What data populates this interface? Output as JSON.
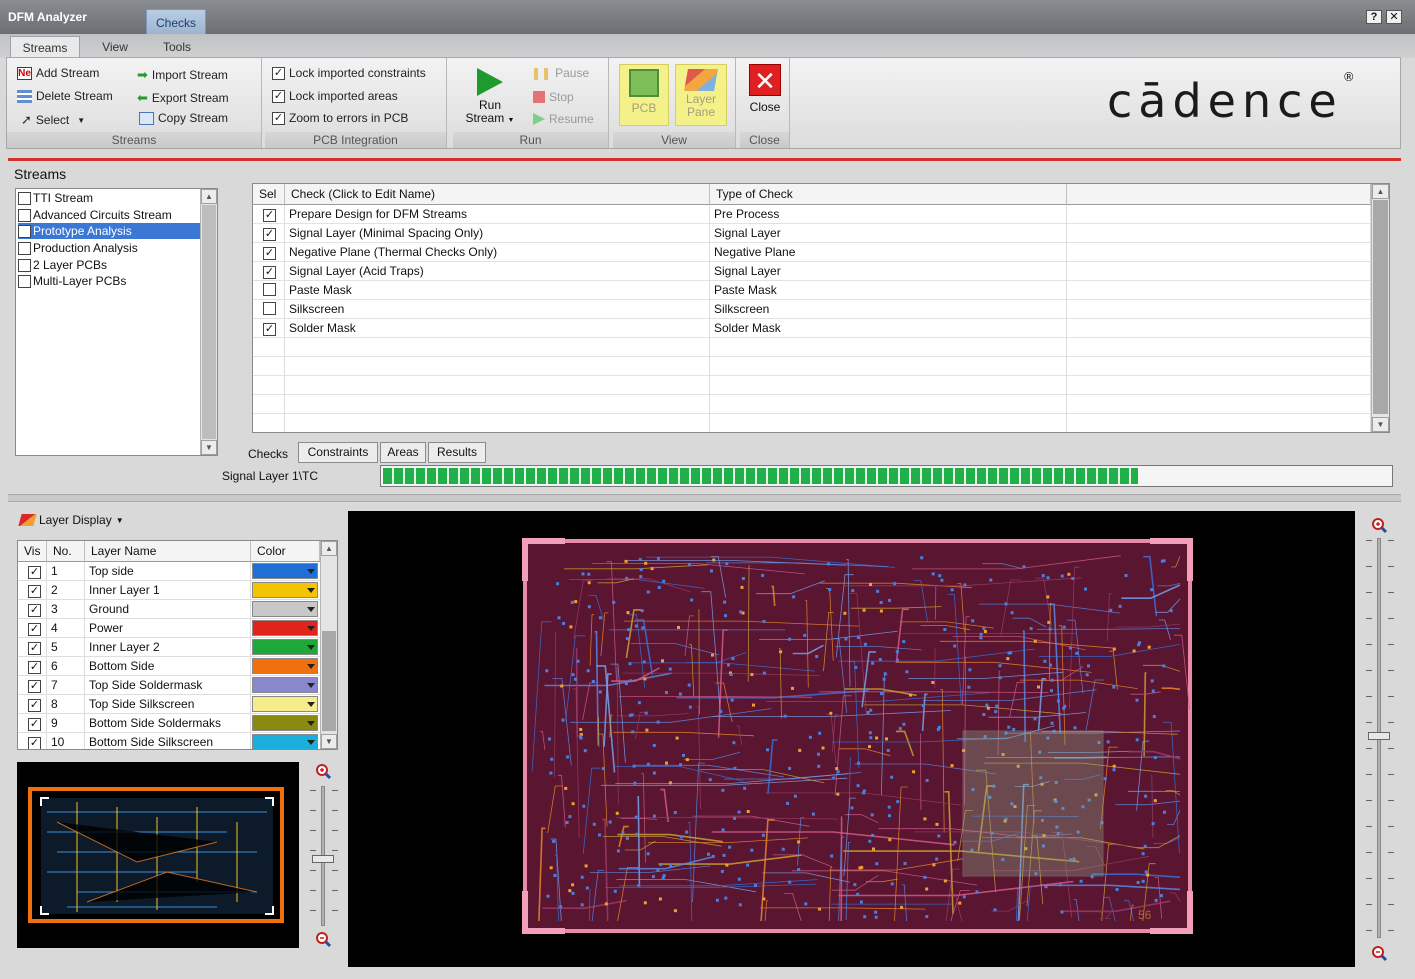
{
  "window": {
    "title": "DFM Analyzer",
    "context_tab": "Checks",
    "help_button": "?",
    "close_button": "✕"
  },
  "ribbon_tabs": [
    "Streams",
    "View",
    "Tools"
  ],
  "ribbon": {
    "streams_group": {
      "label": "Streams",
      "add_stream": "Add Stream",
      "delete_stream": "Delete Stream",
      "select": "Select",
      "import_stream": "Import Stream",
      "export_stream": "Export Stream",
      "copy_stream": "Copy Stream"
    },
    "pcb_integration_group": {
      "label": "PCB Integration",
      "lock_constraints": "Lock imported constraints",
      "lock_areas": "Lock imported areas",
      "zoom_errors": "Zoom to errors in PCB",
      "lock_constraints_checked": true,
      "lock_areas_checked": true,
      "zoom_errors_checked": true
    },
    "run_group": {
      "label": "Run",
      "run_stream_line1": "Run",
      "run_stream_line2": "Stream",
      "pause": "Pause",
      "stop": "Stop",
      "resume": "Resume"
    },
    "view_group": {
      "label": "View",
      "pcb": "PCB",
      "layer_pane_line1": "Layer",
      "layer_pane_line2": "Pane"
    },
    "close_group": {
      "label": "Close",
      "close": "Close"
    },
    "brand_logo": "cādence",
    "brand_registered": "®"
  },
  "streams_panel": {
    "title": "Streams",
    "items": [
      {
        "label": "TTI Stream",
        "checked": false,
        "selected": false
      },
      {
        "label": "Advanced Circuits Stream",
        "checked": false,
        "selected": false
      },
      {
        "label": "Prototype Analysis",
        "checked": true,
        "selected": true
      },
      {
        "label": "Production Analysis",
        "checked": false,
        "selected": false
      },
      {
        "label": "2 Layer PCBs",
        "checked": false,
        "selected": false
      },
      {
        "label": "Multi-Layer PCBs",
        "checked": false,
        "selected": false
      }
    ]
  },
  "checks_grid": {
    "columns": [
      "Sel",
      "Check (Click to Edit Name)",
      "Type of Check"
    ],
    "rows": [
      {
        "sel": true,
        "check": "Prepare Design for DFM Streams",
        "type": "Pre Process"
      },
      {
        "sel": true,
        "check": "Signal Layer (Minimal Spacing Only)",
        "type": "Signal Layer"
      },
      {
        "sel": true,
        "check": "Negative Plane (Thermal Checks Only)",
        "type": "Negative Plane"
      },
      {
        "sel": true,
        "check": "Signal Layer (Acid Traps)",
        "type": "Signal Layer"
      },
      {
        "sel": false,
        "check": "Paste Mask",
        "type": "Paste Mask"
      },
      {
        "sel": false,
        "check": "Silkscreen",
        "type": "Silkscreen"
      },
      {
        "sel": true,
        "check": "Solder Mask",
        "type": "Solder Mask"
      }
    ]
  },
  "bottom_tabs": [
    "Checks",
    "Constraints",
    "Areas",
    "Results"
  ],
  "status": {
    "progress_label": "Signal Layer 1\\TC",
    "progress_fraction": 0.75
  },
  "layer_display": {
    "title": "Layer Display",
    "columns": [
      "Vis",
      "No.",
      "Layer Name",
      "Color"
    ],
    "rows": [
      {
        "vis": true,
        "no": "1",
        "name": "Top side",
        "color": "#1f6fd6"
      },
      {
        "vis": true,
        "no": "2",
        "name": "Inner Layer 1",
        "color": "#f5c400"
      },
      {
        "vis": true,
        "no": "3",
        "name": "Ground",
        "color": "#c8c8c8"
      },
      {
        "vis": true,
        "no": "4",
        "name": "Power",
        "color": "#e2231a"
      },
      {
        "vis": true,
        "no": "5",
        "name": "Inner Layer 2",
        "color": "#1fa83a"
      },
      {
        "vis": true,
        "no": "6",
        "name": "Bottom Side",
        "color": "#f07010"
      },
      {
        "vis": true,
        "no": "7",
        "name": "Top Side Soldermask",
        "color": "#8a88cc"
      },
      {
        "vis": true,
        "no": "8",
        "name": "Top Side Silkscreen",
        "color": "#f7ec8a"
      },
      {
        "vis": true,
        "no": "9",
        "name": "Bottom Side Soldermaks",
        "color": "#8a8a10"
      },
      {
        "vis": true,
        "no": "10",
        "name": "Bottom Side Silkscreen",
        "color": "#1aaedc"
      }
    ]
  },
  "canvas": {
    "board_label_1": "12",
    "board_label_2": "56"
  },
  "colors": {
    "accent_red": "#d7322a",
    "progress_green": "#1fb04a",
    "selection_blue": "#3b78d6",
    "board_fill": "#5a1530",
    "board_outline": "#e88aa8"
  }
}
